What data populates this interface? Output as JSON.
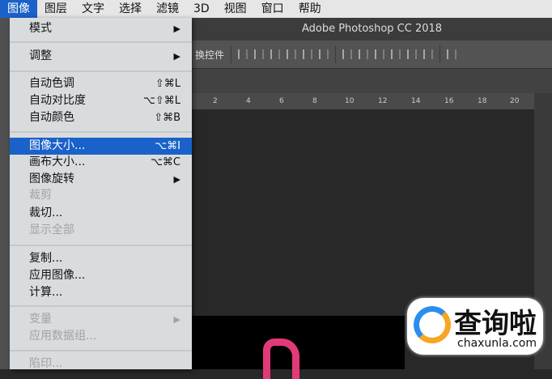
{
  "menubar": [
    "图像",
    "图层",
    "文字",
    "选择",
    "滤镜",
    "3D",
    "视图",
    "窗口",
    "帮助"
  ],
  "window_title": "Adobe Photoshop CC 2018",
  "options_label": "换控件",
  "ruler": [
    "2",
    "4",
    "6",
    "8",
    "10",
    "12",
    "14",
    "16",
    "18",
    "20"
  ],
  "menu": {
    "mode": "模式",
    "adjust": "调整",
    "auto_tone": "自动色调",
    "auto_tone_sc": "⇧⌘L",
    "auto_contrast": "自动对比度",
    "auto_contrast_sc": "⌥⇧⌘L",
    "auto_color": "自动颜色",
    "auto_color_sc": "⇧⌘B",
    "image_size": "图像大小...",
    "image_size_sc": "⌥⌘I",
    "canvas_size": "画布大小...",
    "canvas_size_sc": "⌥⌘C",
    "rotate": "图像旋转",
    "crop": "裁剪",
    "trim": "裁切...",
    "reveal_all": "显示全部",
    "duplicate": "复制...",
    "apply_image": "应用图像...",
    "calculations": "计算...",
    "variables": "变量",
    "apply_data_set": "应用数据组...",
    "trap": "陷印..."
  },
  "watermark": {
    "cn": "查询啦",
    "en": "chaxunla.com"
  }
}
